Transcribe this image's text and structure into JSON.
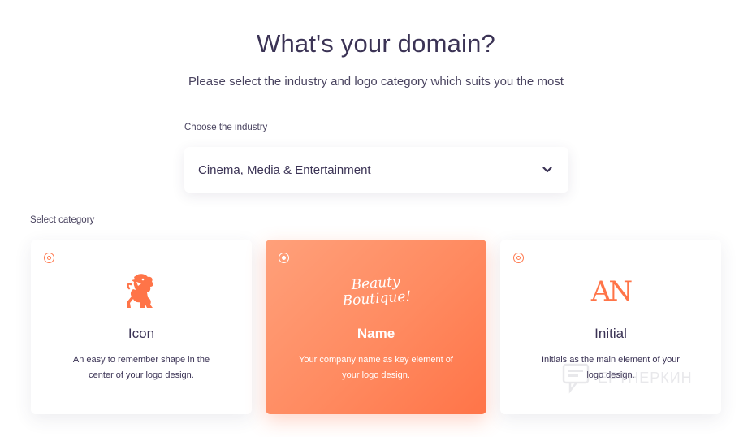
{
  "header": {
    "title": "What's your domain?",
    "subtitle": "Please select the industry and logo category which suits you the most"
  },
  "industry": {
    "label": "Choose the industry",
    "selected": "Cinema, Media & Entertainment"
  },
  "category": {
    "label": "Select category",
    "selected_index": 1,
    "cards": [
      {
        "title": "Icon",
        "description": "An easy to remember shape in the center of your logo design.",
        "icon": "lion-icon"
      },
      {
        "title": "Name",
        "description": "Your company name as key element of your logo design.",
        "sample_text_line1": "Beauty",
        "sample_text_line2": "Boutique!"
      },
      {
        "title": "Initial",
        "description": "Initials as the main element of your logo design.",
        "sample_initials": "AN"
      }
    ]
  },
  "watermark": {
    "text": "ЕРТНЕРКИН"
  },
  "colors": {
    "accent": "#ff7a50",
    "text": "#3b3355",
    "selected_gradient_start": "#ffa07a",
    "selected_gradient_end": "#ff7448"
  }
}
